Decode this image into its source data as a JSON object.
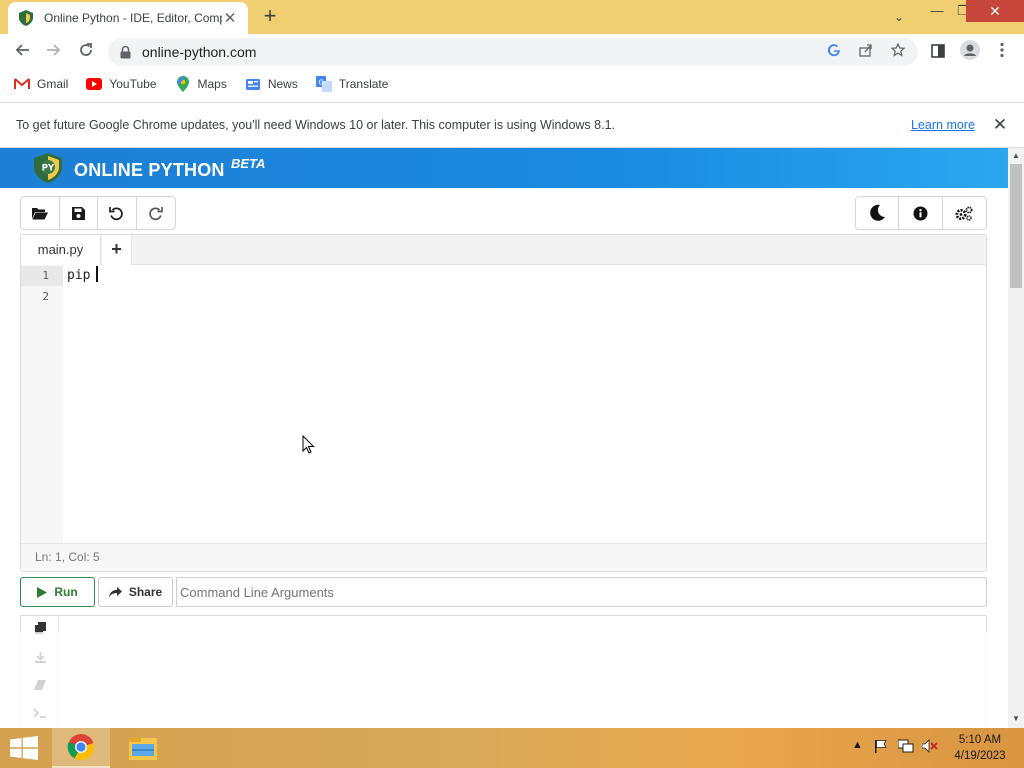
{
  "browser": {
    "tab_title": "Online Python - IDE, Editor, Compiler",
    "tab_close": "✕",
    "new_tab": "+",
    "url": "online-python.com",
    "window_controls": {
      "dropdown": "⌄",
      "minimize": "—",
      "maximize": "❐",
      "close": "✕"
    }
  },
  "bookmarks": [
    {
      "label": "Gmail",
      "icon": "gmail-icon"
    },
    {
      "label": "YouTube",
      "icon": "youtube-icon"
    },
    {
      "label": "Maps",
      "icon": "maps-icon"
    },
    {
      "label": "News",
      "icon": "news-icon"
    },
    {
      "label": "Translate",
      "icon": "translate-icon"
    }
  ],
  "infobar": {
    "message": "To get future Google Chrome updates, you'll need Windows 10 or later. This computer is using Windows 8.1.",
    "link": "Learn more",
    "close": "✕"
  },
  "site": {
    "title": "ONLINE PYTHON",
    "beta": "BETA",
    "logo_text": "PY",
    "brand_color": "#1d80d6"
  },
  "toolbar_left": [
    "folder-open-icon",
    "save-icon",
    "undo-icon",
    "redo-icon"
  ],
  "toolbar_right": [
    "moon-icon",
    "info-icon",
    "settings-icon"
  ],
  "editor": {
    "tab_label": "main.py",
    "add_tab": "+",
    "line_numbers": [
      "1",
      "2"
    ],
    "lines": [
      "pip",
      ""
    ],
    "status": "Ln: 1,  Col: 5"
  },
  "run": {
    "run_label": "Run",
    "share_label": "Share",
    "args_placeholder": "Command Line Arguments",
    "run_color": "#2e7d32"
  },
  "taskbar": {
    "time": "5:10 AM",
    "date": "4/19/2023"
  }
}
